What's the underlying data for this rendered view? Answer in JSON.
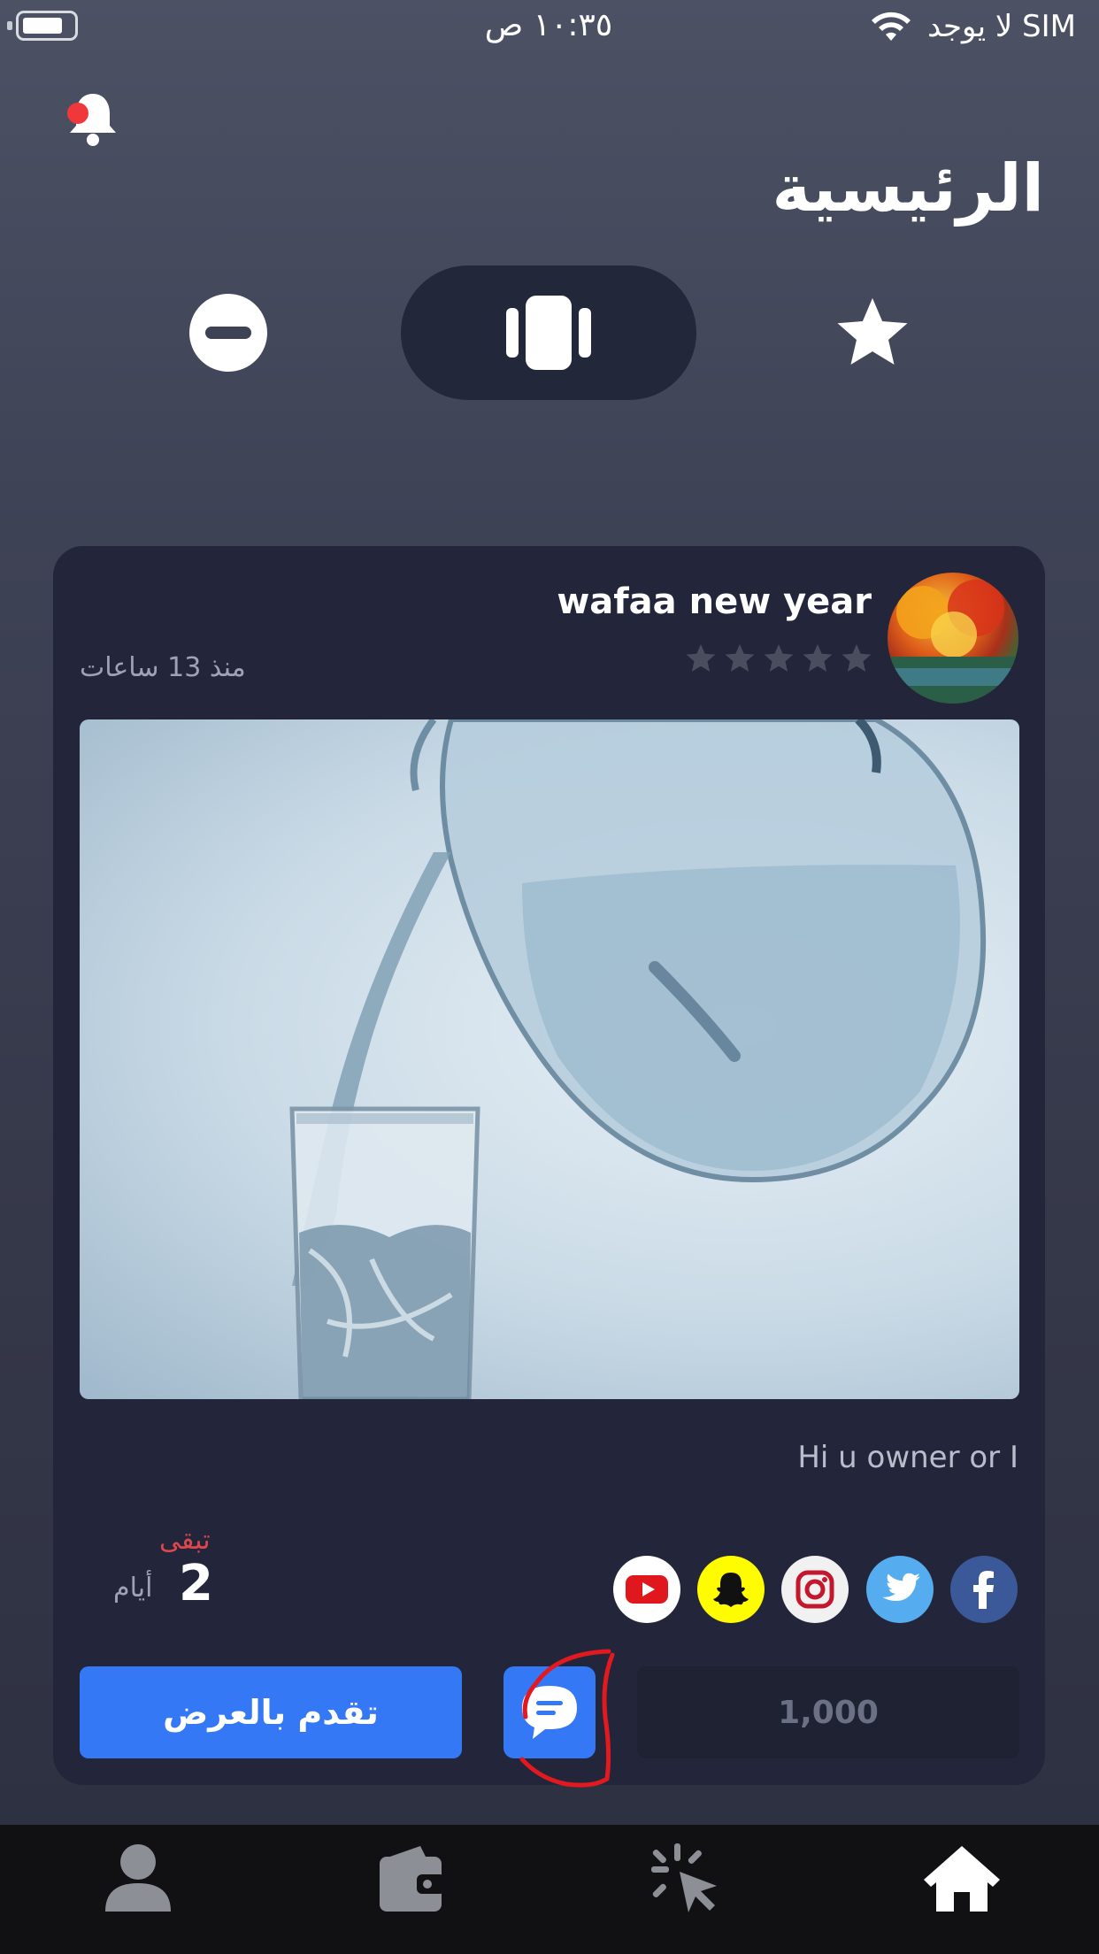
{
  "status_bar": {
    "time": "١٠:٣٥ ص",
    "carrier": "لا يوجد SIM"
  },
  "header": {
    "title": "الرئيسية",
    "notification_icon": "bell-icon",
    "has_unread": true
  },
  "filters": [
    {
      "name": "favorites",
      "icon": "star-icon",
      "active": false
    },
    {
      "name": "cards",
      "icon": "cards-icon",
      "active": true
    },
    {
      "name": "blocked",
      "icon": "minus-circle-icon",
      "active": false
    }
  ],
  "post": {
    "username": "wafaa new year",
    "rating": 0,
    "rating_max": 5,
    "posted_ago": "منذ 13 ساعات",
    "description": "Hi u owner or I",
    "remaining_label": "تبقى",
    "remaining_days": "2",
    "remaining_unit": "أيام",
    "social": [
      "facebook",
      "twitter",
      "instagram",
      "snapchat",
      "youtube"
    ],
    "bid_button": "تقدم بالعرض",
    "price": "1,000"
  },
  "tab_bar": [
    {
      "name": "profile",
      "icon": "person-icon",
      "active": false
    },
    {
      "name": "wallet",
      "icon": "wallet-icon",
      "active": false
    },
    {
      "name": "auctions",
      "icon": "cursor-click-icon",
      "active": false
    },
    {
      "name": "home",
      "icon": "home-icon",
      "active": true
    }
  ],
  "colors": {
    "accent": "#3478f6",
    "card_bg": "#23263a",
    "danger": "#e0474c",
    "tab_bar_bg": "#111114"
  }
}
